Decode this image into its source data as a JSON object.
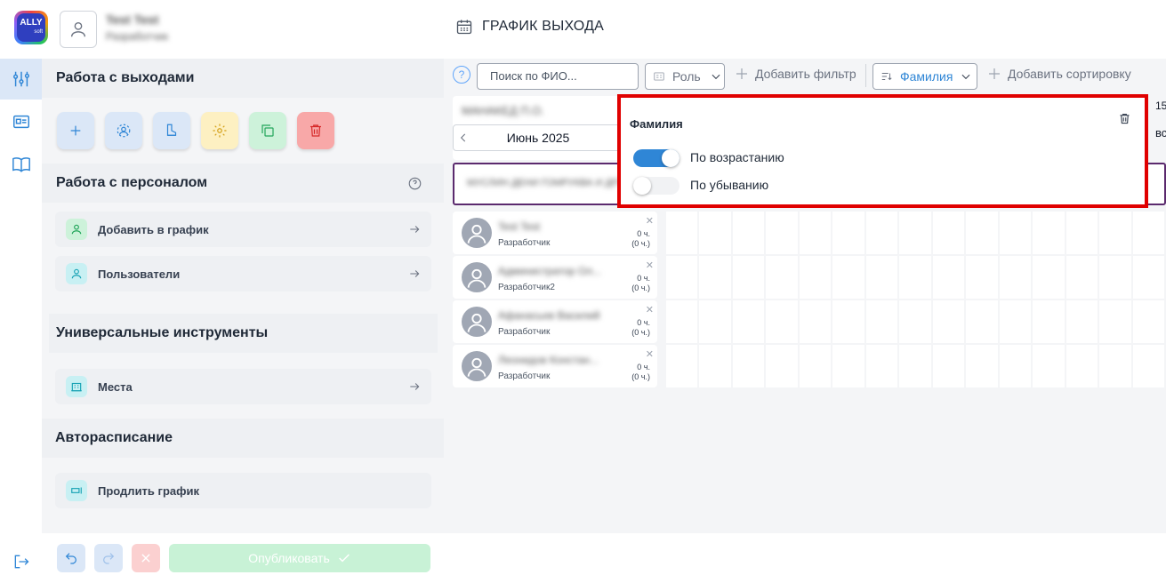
{
  "header": {
    "logo_text": "ALLY",
    "logo_sub": "soft",
    "user_name": "Test Test",
    "user_role": "Разработчик",
    "page_title": "ГРАФИК ВЫХОДА"
  },
  "sidebar_rail": {
    "icons": [
      "sliders-icon",
      "id-card-icon",
      "book-icon"
    ],
    "logout_icon": "logout-icon"
  },
  "panel": {
    "exits_title": "Работа с выходами",
    "tools": [
      "plus-icon",
      "face-scan-icon",
      "boot-icon",
      "gear-icon",
      "copy-icon",
      "trash-icon"
    ],
    "personnel_title": "Работа с персоналом",
    "personnel_items": [
      {
        "label": "Добавить в график"
      },
      {
        "label": "Пользователи"
      }
    ],
    "universal_title": "Универсальные инструменты",
    "universal_items": [
      {
        "label": "Места"
      }
    ],
    "auto_title": "Авторасписание",
    "auto_items": [
      {
        "label": "Продлить график"
      }
    ]
  },
  "bottom": {
    "publish_label": "Опубликовать"
  },
  "filters": {
    "help": "?",
    "search_placeholder": "Поиск по ФИО...",
    "role_label": "Роль",
    "add_filter": "Добавить фильтр",
    "sort_label": "Фамилия",
    "add_sort": "Добавить сортировку"
  },
  "schedule": {
    "group_name": "МАНАКЕД П.О.",
    "month": "Июнь 2025",
    "day_num": "15",
    "day_abbr": "вс",
    "department_blurred": "МУСЛИН ДЕНИ ГОМРУКВА И ДРУГИЕ"
  },
  "employees": [
    {
      "name": "Test Test",
      "role": "Разработчик",
      "hours": "0 ч.",
      "hours_sub": "(0 ч.)"
    },
    {
      "name": "Администратор Ол...",
      "role": "Разработчик2",
      "hours": "0 ч.",
      "hours_sub": "(0 ч.)"
    },
    {
      "name": "Афанасьев Василий",
      "role": "Разработчик",
      "hours": "0 ч.",
      "hours_sub": "(0 ч.)"
    },
    {
      "name": "Леонидов Констан...",
      "role": "Разработчик",
      "hours": "0 ч.",
      "hours_sub": "(0 ч.)"
    }
  ],
  "sort_popup": {
    "title": "Фамилия",
    "options": [
      {
        "label": "По возрастанию",
        "on": true
      },
      {
        "label": "По убыванию",
        "on": false
      }
    ]
  },
  "colors": {
    "accent": "#2f86d6",
    "popup_border": "#e00000",
    "department_border": "#5b2a6e",
    "publish_bg": "#c8f2d6"
  }
}
